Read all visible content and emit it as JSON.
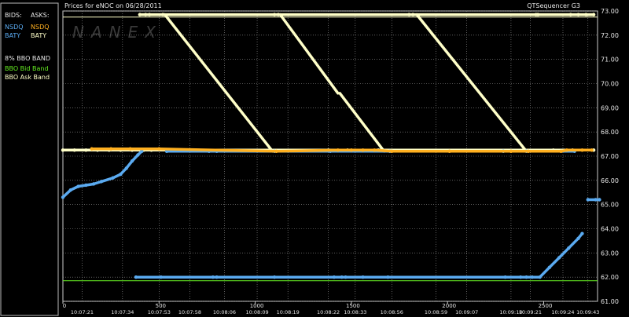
{
  "header": {
    "title": "Prices for  eNOC  on  06/28/2011",
    "app": "QTSequencer G3",
    "watermark": "NANEX"
  },
  "legend": {
    "bids_label": "BIDS:",
    "asks_label": "ASKS:",
    "bid_entries": [
      {
        "text": "NSDQ",
        "color": "#5aaaf0"
      },
      {
        "text": "BATY",
        "color": "#5aaaf0"
      }
    ],
    "ask_entries": [
      {
        "text": "NSDQ",
        "color": "#ffb020"
      },
      {
        "text": "BATY",
        "color": "#ffffc8"
      }
    ],
    "band_title": "8% BBO BAND",
    "band_entries": [
      {
        "text": "BBO Bid Band",
        "color": "#66ee22"
      },
      {
        "text": "BBO Ask Band",
        "color": "#ffffc8"
      }
    ]
  },
  "chart_data": {
    "type": "scatter",
    "ylim": [
      61,
      73
    ],
    "xlim": [
      0,
      2780
    ],
    "grid": true,
    "y_ticks": [
      "73.00",
      "72.00",
      "71.00",
      "70.00",
      "69.00",
      "68.00",
      "67.00",
      "66.00",
      "65.00",
      "64.00",
      "63.00",
      "62.00",
      "61.00"
    ],
    "y_tick_values": [
      73,
      72,
      71,
      70,
      69,
      68,
      67,
      66,
      65,
      64,
      63,
      62,
      61
    ],
    "x_ticks": [
      {
        "value": 0,
        "label": "0"
      },
      {
        "value": 500,
        "label": "500"
      },
      {
        "value": 1000,
        "label": "1000"
      },
      {
        "value": 1500,
        "label": "1500"
      },
      {
        "value": 2000,
        "label": "2000"
      },
      {
        "value": 2500,
        "label": "2500"
      }
    ],
    "time_ticks": [
      {
        "value": 100,
        "label": "10:07:21"
      },
      {
        "value": 310,
        "label": "10:07:34"
      },
      {
        "value": 500,
        "label": "10:07:53"
      },
      {
        "value": 660,
        "label": "10:07:58"
      },
      {
        "value": 840,
        "label": "10:08:06"
      },
      {
        "value": 1010,
        "label": "10:08:09"
      },
      {
        "value": 1170,
        "label": "10:08:19"
      },
      {
        "value": 1380,
        "label": "10:08:22"
      },
      {
        "value": 1520,
        "label": "10:08:33"
      },
      {
        "value": 1710,
        "label": "10:08:56"
      },
      {
        "value": 1940,
        "label": "10:08:59"
      },
      {
        "value": 2100,
        "label": "10:09:07"
      },
      {
        "value": 2330,
        "label": "10:09:10"
      },
      {
        "value": 2430,
        "label": "10:09:21"
      },
      {
        "value": 2600,
        "label": "10:09:24"
      },
      {
        "value": 2730,
        "label": "10:09:43"
      }
    ],
    "series": [
      {
        "color": "#ffffc8",
        "points": [
          [
            0,
            67.25
          ],
          [
            60,
            67.25
          ],
          [
            120,
            67.25
          ],
          [
            180,
            67.25
          ],
          [
            240,
            67.25
          ],
          [
            300,
            67.25
          ],
          [
            360,
            67.25
          ],
          [
            420,
            67.25
          ],
          [
            460,
            67.25
          ],
          [
            1380,
            67.25
          ],
          [
            1480,
            67.25
          ],
          [
            1640,
            67.25
          ],
          [
            2550,
            67.25
          ],
          [
            2650,
            67.25
          ],
          [
            2760,
            67.25
          ]
        ]
      },
      {
        "color": "#ffffc8",
        "points": [
          [
            400,
            72.85
          ],
          [
            430,
            72.85
          ],
          [
            450,
            72.85
          ],
          [
            520,
            72.85
          ],
          [
            1100,
            72.85
          ],
          [
            1120,
            72.85
          ],
          [
            1800,
            72.85
          ],
          [
            1820,
            72.85
          ],
          [
            2460,
            72.85
          ],
          [
            2470,
            72.85
          ],
          [
            2640,
            72.85
          ],
          [
            2680,
            72.85
          ],
          [
            2720,
            72.85
          ],
          [
            2760,
            72.85
          ]
        ]
      },
      {
        "color": "#5aaaf0",
        "points": [
          [
            540,
            67.2
          ],
          [
            760,
            67.2
          ],
          [
            800,
            67.2
          ],
          [
            1100,
            67.2
          ],
          [
            1390,
            67.2
          ],
          [
            1700,
            67.2
          ],
          [
            2290,
            67.2
          ],
          [
            2410,
            67.2
          ],
          [
            2660,
            67.2
          ]
        ]
      },
      {
        "color": "#5aaaf0",
        "points": [
          [
            0,
            65.3
          ],
          [
            40,
            65.6
          ],
          [
            80,
            65.75
          ],
          [
            120,
            65.8
          ],
          [
            160,
            65.85
          ],
          [
            200,
            65.95
          ],
          [
            260,
            66.1
          ],
          [
            300,
            66.25
          ],
          [
            330,
            66.5
          ],
          [
            360,
            66.8
          ],
          [
            390,
            67.05
          ],
          [
            410,
            67.2
          ]
        ]
      },
      {
        "color": "#5aaaf0",
        "points": [
          [
            380,
            62.0
          ],
          [
            510,
            62.0
          ],
          [
            780,
            62.0
          ],
          [
            800,
            62.0
          ],
          [
            1100,
            62.0
          ],
          [
            1410,
            62.0
          ],
          [
            1450,
            62.0
          ],
          [
            1470,
            62.0
          ],
          [
            1560,
            62.0
          ],
          [
            1690,
            62.0
          ],
          [
            2300,
            62.0
          ],
          [
            2380,
            62.0
          ],
          [
            2410,
            62.0
          ],
          [
            2440,
            62.0
          ],
          [
            2480,
            62.0
          ],
          [
            2530,
            62.4
          ],
          [
            2580,
            62.8
          ],
          [
            2630,
            63.2
          ],
          [
            2680,
            63.6
          ],
          [
            2700,
            63.8
          ]
        ]
      },
      {
        "color": "#5aaaf0",
        "points": [
          [
            2730,
            65.2
          ],
          [
            2770,
            65.2
          ],
          [
            2790,
            65.2
          ]
        ]
      },
      {
        "color": "#ffb020",
        "points": [
          [
            150,
            67.3
          ],
          [
            250,
            67.3
          ],
          [
            350,
            67.3
          ],
          [
            500,
            67.3
          ],
          [
            1110,
            67.2
          ],
          [
            1430,
            67.25
          ],
          [
            1500,
            67.25
          ],
          [
            1560,
            67.25
          ],
          [
            1620,
            67.25
          ],
          [
            1710,
            67.2
          ],
          [
            2010,
            67.2
          ],
          [
            2330,
            67.2
          ],
          [
            2420,
            67.2
          ],
          [
            2590,
            67.2
          ],
          [
            2620,
            67.25
          ],
          [
            2700,
            67.25
          ],
          [
            2750,
            67.25
          ]
        ]
      }
    ],
    "step_lines": [
      {
        "color": "#ffffc8",
        "points": [
          [
            530,
            72.85
          ],
          [
            1090,
            67.2
          ]
        ]
      },
      {
        "color": "#ffffc8",
        "points": [
          [
            1130,
            72.85
          ],
          [
            1430,
            69.6
          ]
        ]
      },
      {
        "color": "#ffffc8",
        "points": [
          [
            1440,
            69.6
          ],
          [
            1670,
            67.2
          ]
        ]
      },
      {
        "color": "#ffffc8",
        "points": [
          [
            1840,
            72.85
          ],
          [
            2410,
            67.2
          ]
        ]
      }
    ],
    "band_lines": [
      {
        "color": "#66ee22",
        "value": 61.85
      },
      {
        "color": "#ffffc8",
        "value": 72.75
      }
    ]
  }
}
